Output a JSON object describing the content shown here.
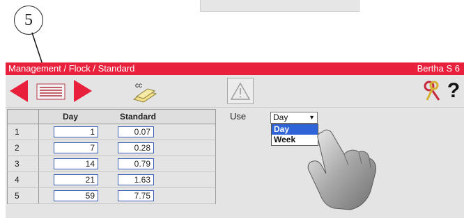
{
  "callout": {
    "number": "5"
  },
  "header": {
    "breadcrumb": "Management / Flock / Standard",
    "device": "Bertha S 6"
  },
  "toolbar": {
    "prev_icon": "arrow-left-icon",
    "list_icon": "list-icon",
    "next_icon": "arrow-right-icon",
    "copy_label": "cc",
    "warning_icon": "warning-icon",
    "keys_icon": "keys-icon",
    "help_label": "?"
  },
  "colors": {
    "title_bar": "#e8203c",
    "arrow": "#e8203c",
    "selection": "#2e64d8"
  },
  "table": {
    "headers": {
      "day": "Day",
      "standard": "Standard"
    },
    "rows": [
      {
        "index": "1",
        "day": "1",
        "standard": "0.07"
      },
      {
        "index": "2",
        "day": "7",
        "standard": "0.28"
      },
      {
        "index": "3",
        "day": "14",
        "standard": "0.79"
      },
      {
        "index": "4",
        "day": "21",
        "standard": "1.63"
      },
      {
        "index": "5",
        "day": "59",
        "standard": "7.75"
      }
    ]
  },
  "use": {
    "label": "Use",
    "selected": "Day",
    "options": [
      {
        "label": "Day",
        "highlighted": true
      },
      {
        "label": "Week",
        "highlighted": false
      }
    ]
  }
}
